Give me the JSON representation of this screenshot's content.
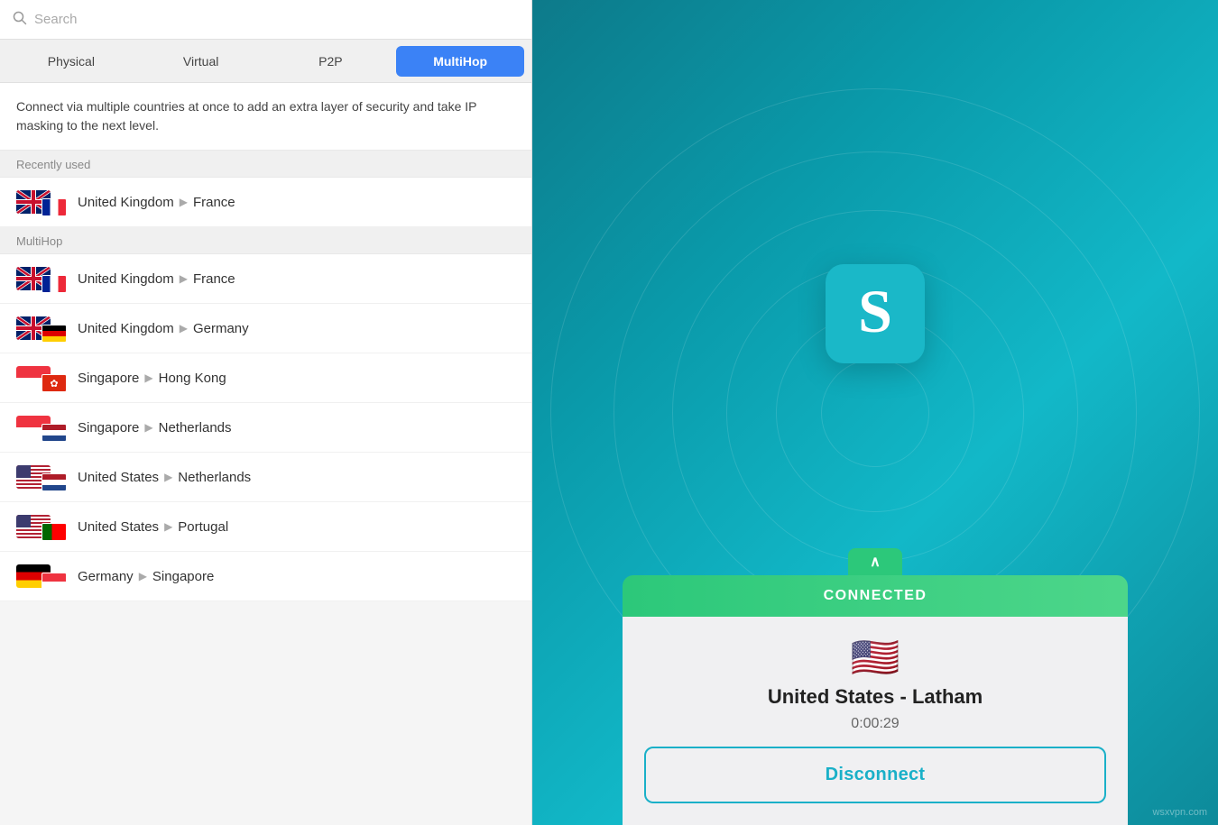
{
  "search": {
    "placeholder": "Search"
  },
  "tabs": [
    {
      "id": "physical",
      "label": "Physical",
      "active": false
    },
    {
      "id": "virtual",
      "label": "Virtual",
      "active": false
    },
    {
      "id": "p2p",
      "label": "P2P",
      "active": false
    },
    {
      "id": "multihop",
      "label": "MultiHop",
      "active": true
    }
  ],
  "description": "Connect via multiple countries at once to add an extra layer of security and take IP masking to the next level.",
  "sections": [
    {
      "title": "Recently used",
      "items": [
        {
          "from": "United Kingdom",
          "to": "France"
        }
      ]
    },
    {
      "title": "MultiHop",
      "items": [
        {
          "from": "United Kingdom",
          "to": "France"
        },
        {
          "from": "United Kingdom",
          "to": "Germany"
        },
        {
          "from": "Singapore",
          "to": "Hong Kong"
        },
        {
          "from": "Singapore",
          "to": "Netherlands"
        },
        {
          "from": "United States",
          "to": "Netherlands"
        },
        {
          "from": "United States",
          "to": "Portugal"
        },
        {
          "from": "Germany",
          "to": "Singapore"
        }
      ]
    }
  ],
  "right": {
    "status": "CONNECTED",
    "country": "United States - Latham",
    "flag": "🇺🇸",
    "timer": "0:00:29",
    "disconnect_label": "Disconnect",
    "watermark": "wsxvpn.com"
  }
}
